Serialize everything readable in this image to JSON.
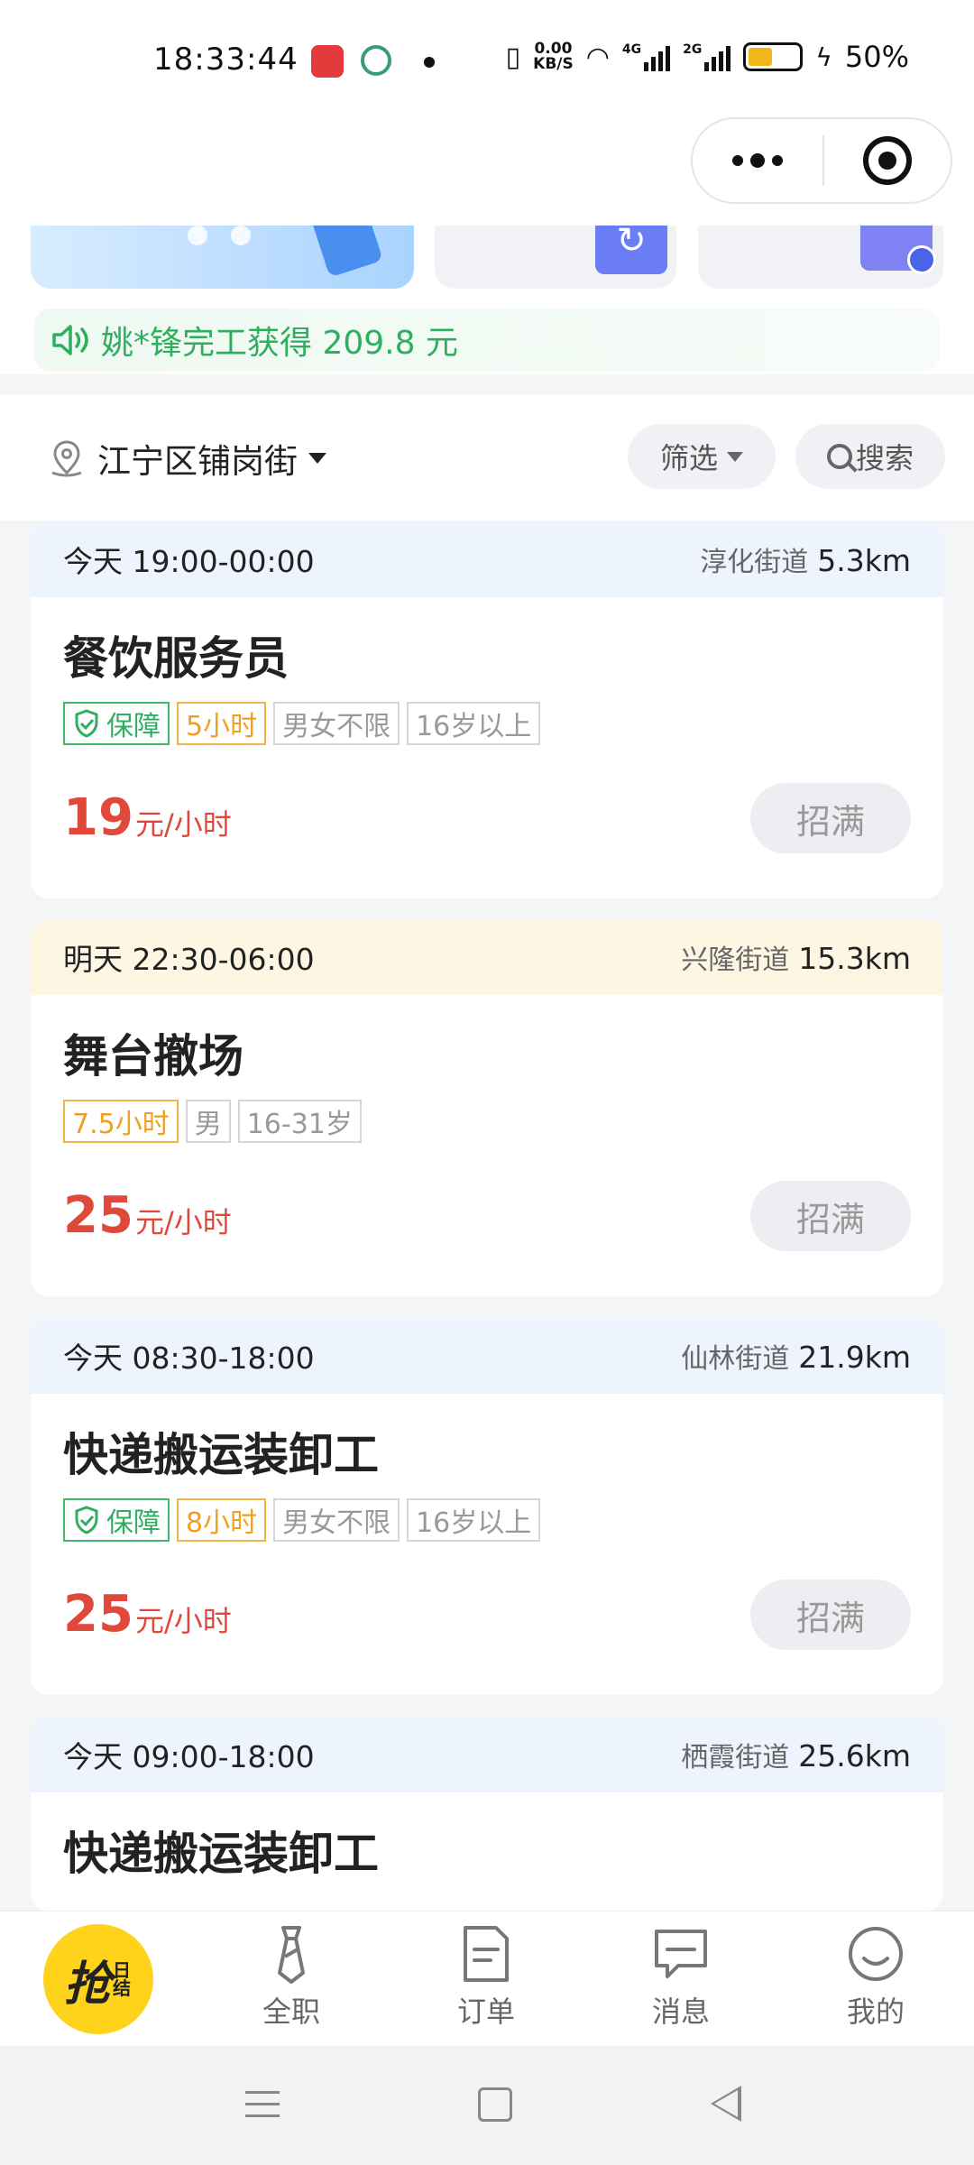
{
  "status_bar": {
    "time": "18:33:44",
    "net_speed_value": "0.00",
    "net_speed_unit": "KB/S",
    "net1": "4G",
    "net2": "2G",
    "battery": "50%"
  },
  "notice": {
    "text": "姚*锋完工获得 209.8 元",
    "icon": "speaker-icon",
    "color": "#2fae5f"
  },
  "location_bar": {
    "location": "江宁区铺岗街",
    "filter_label": "筛选",
    "search_label": "搜索"
  },
  "jobs": [
    {
      "time": "今天 19:00-00:00",
      "area": "淳化街道",
      "distance": "5.3km",
      "title": "餐饮服务员",
      "guarantee": "保障",
      "hours": "5小时",
      "gender": "男女不限",
      "age": "16岁以上",
      "price": "19",
      "unit": "元/小时",
      "status": "招满"
    },
    {
      "time": "明天 22:30-06:00",
      "area": "兴隆街道",
      "distance": "15.3km",
      "title": "舞台撤场",
      "hours": "7.5小时",
      "gender": "男",
      "age": "16-31岁",
      "price": "25",
      "unit": "元/小时",
      "status": "招满"
    },
    {
      "time": "今天 08:30-18:00",
      "area": "仙林街道",
      "distance": "21.9km",
      "title": "快递搬运装卸工",
      "guarantee": "保障",
      "hours": "8小时",
      "gender": "男女不限",
      "age": "16岁以上",
      "price": "25",
      "unit": "元/小时",
      "status": "招满"
    },
    {
      "time": "今天 09:00-18:00",
      "area": "栖霞街道",
      "distance": "25.6km",
      "title": "快递搬运装卸工"
    }
  ],
  "tabbar": {
    "grab_main": "抢",
    "grab_sub": "日结",
    "tabs": [
      {
        "label": "全职",
        "icon": "tie-icon"
      },
      {
        "label": "订单",
        "icon": "document-icon"
      },
      {
        "label": "消息",
        "icon": "message-icon"
      },
      {
        "label": "我的",
        "icon": "smile-icon"
      }
    ]
  },
  "colors": {
    "price": "#e0483c",
    "accent_yellow": "#ffd21c",
    "tag_green": "#2fae5f",
    "tag_orange": "#f0a020"
  }
}
